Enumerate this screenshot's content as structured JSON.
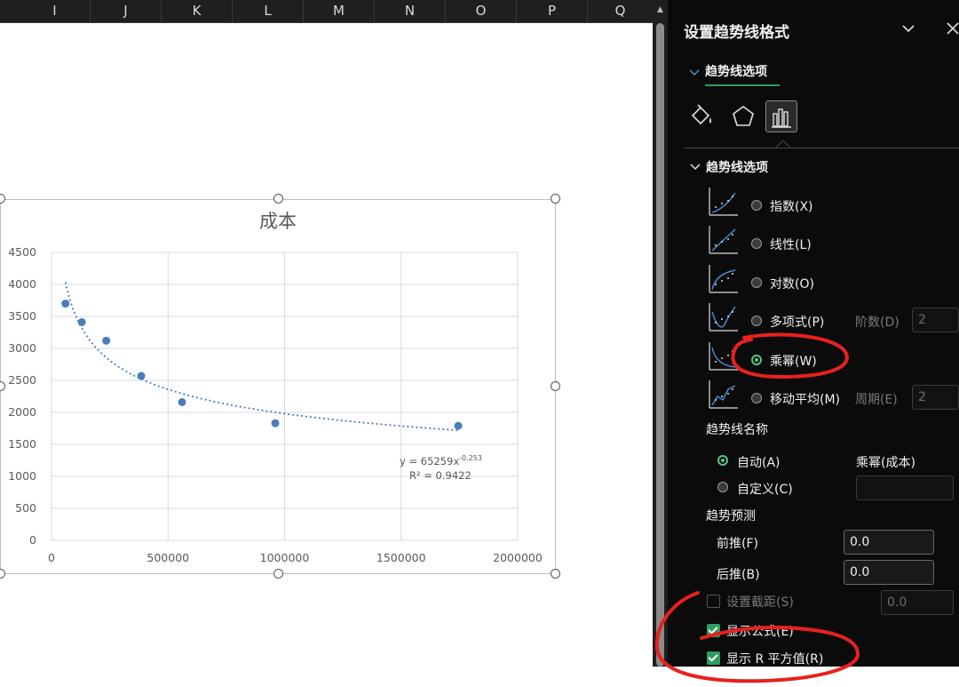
{
  "columns": [
    "I",
    "J",
    "K",
    "L",
    "M",
    "N",
    "O",
    "P",
    "Q"
  ],
  "chart_data": {
    "type": "scatter",
    "title": "成本",
    "xlabel": "",
    "ylabel": "",
    "xlim": [
      0,
      2000000
    ],
    "ylim": [
      0,
      4500
    ],
    "x_ticks": [
      "0",
      "500000",
      "1000000",
      "1500000",
      "2000000"
    ],
    "y_ticks": [
      "0",
      "500",
      "1000",
      "1500",
      "2000",
      "2500",
      "3000",
      "3500",
      "4000",
      "4500"
    ],
    "grid": true,
    "legend": "none",
    "series": [
      {
        "marker_color": "#4a7ebb",
        "points": [
          {
            "x": 60000,
            "y": 3700
          },
          {
            "x": 130000,
            "y": 3410
          },
          {
            "x": 235000,
            "y": 3120
          },
          {
            "x": 385000,
            "y": 2570
          },
          {
            "x": 560000,
            "y": 2160
          },
          {
            "x": 960000,
            "y": 1830
          },
          {
            "x": 1745000,
            "y": 1790
          }
        ]
      }
    ],
    "trendline": {
      "type": "power",
      "coefficient": 65259,
      "exponent": -0.253,
      "x_range": [
        60000,
        1745000
      ],
      "style": "dotted",
      "color": "#4a7ebb",
      "equation_prefix": "y = 65259x",
      "equation_exponent": "-0.253",
      "r2_label": "R² = 0.9422"
    }
  },
  "panel": {
    "title": "设置趋势线格式",
    "tab": "趋势线选项",
    "section": "趋势线选项",
    "options": [
      {
        "label": "指数(X)",
        "selected": false,
        "extra_label": "",
        "extra_value": ""
      },
      {
        "label": "线性(L)",
        "selected": false,
        "extra_label": "",
        "extra_value": ""
      },
      {
        "label": "对数(O)",
        "selected": false,
        "extra_label": "",
        "extra_value": ""
      },
      {
        "label": "多项式(P)",
        "selected": false,
        "extra_label": "阶数(D)",
        "extra_value": "2"
      },
      {
        "label": "乘幂(W)",
        "selected": true,
        "extra_label": "",
        "extra_value": ""
      },
      {
        "label": "移动平均(M)",
        "selected": false,
        "extra_label": "周期(E)",
        "extra_value": "2"
      }
    ],
    "name_section": "趋势线名称",
    "name_auto": "自动(A)",
    "name_auto_value": "乘幂(成本)",
    "name_custom": "自定义(C)",
    "forecast_section": "趋势预测",
    "forward_label": "前推(F)",
    "forward_value": "0.0",
    "backward_label": "后推(B)",
    "backward_value": "0.0",
    "intercept_label": "设置截距(S)",
    "intercept_value": "0.0",
    "show_equation": "显示公式(E)",
    "show_r2": "显示 R 平方值(R)"
  },
  "annotation_color": "#e8211d"
}
